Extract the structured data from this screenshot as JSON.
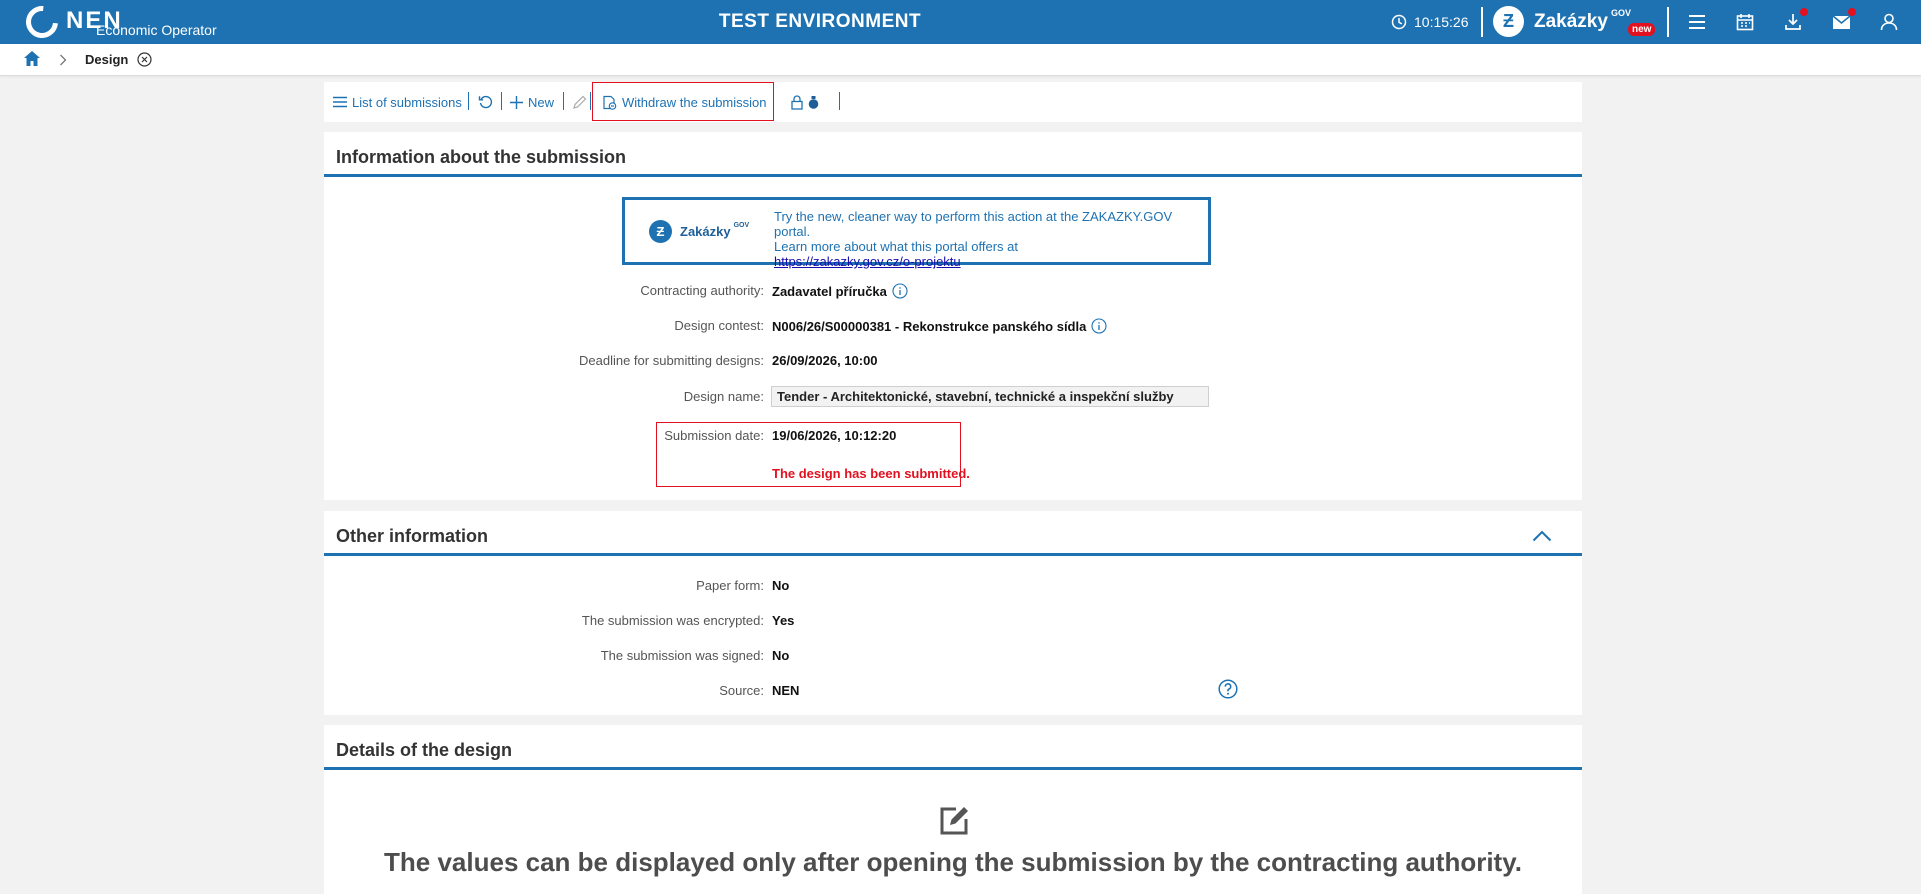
{
  "header": {
    "logo_text": "NEN",
    "logo_subtitle": "Economic Operator",
    "environment": "TEST ENVIRONMENT",
    "clock": "10:15:26",
    "portal_name": "Zakázky",
    "portal_sup": "GOV",
    "portal_badge": "new",
    "icons": [
      "clock-icon",
      "menu-icon",
      "calendar-icon",
      "download-icon",
      "mail-icon",
      "user-icon"
    ]
  },
  "breadcrumb": {
    "current": "Design"
  },
  "toolbar": {
    "list_label": "List of submissions",
    "new_label": "New",
    "withdraw_label": "Withdraw the submission"
  },
  "info": {
    "title": "Information about the submission",
    "banner": {
      "brand": "Zakázky",
      "brand_sup": "GOV",
      "line1": "Try the new, cleaner way to perform this action at the ZAKAZKY.GOV portal.",
      "line2": "Learn more about what this portal offers at",
      "link": "https://zakazky.gov.cz/o-projektu"
    },
    "fields": {
      "authority_label": "Contracting authority:",
      "authority_value": "Zadavatel příručka",
      "contest_label": "Design contest:",
      "contest_value": "N006/26/S00000381 - Rekonstrukce panského sídla",
      "deadline_label": "Deadline for submitting designs:",
      "deadline_value": "26/09/2026, 10:00",
      "name_label": "Design name:",
      "name_value": "Tender - Architektonické, stavební, technické a inspekční služby",
      "date_label": "Submission date:",
      "date_value": "19/06/2026, 10:12:20",
      "status": "The design has been submitted."
    }
  },
  "other": {
    "title": "Other information",
    "paper_label": "Paper form:",
    "paper_value": "No",
    "encrypted_label": "The submission was encrypted:",
    "encrypted_value": "Yes",
    "signed_label": "The submission was signed:",
    "signed_value": "No",
    "source_label": "Source:",
    "source_value": "NEN"
  },
  "details": {
    "title": "Details of the design",
    "message": "The values can be displayed only after opening the submission by the contracting authority."
  },
  "colors": {
    "primary": "#1e72b2",
    "alert": "#e3101f",
    "background": "#f2f2f2"
  }
}
